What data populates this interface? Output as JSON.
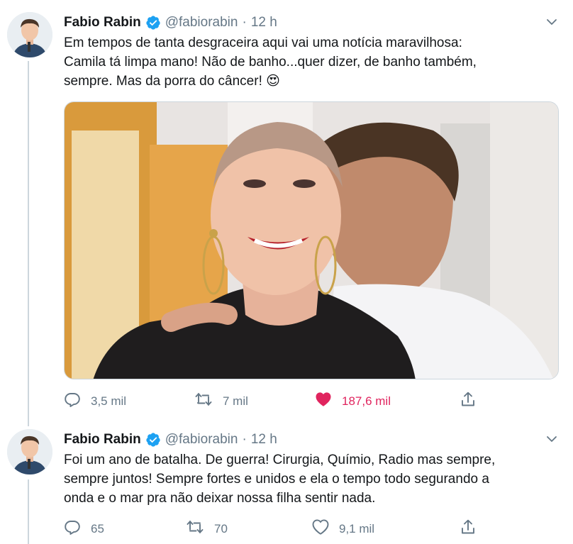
{
  "tweets": [
    {
      "name": "Fabio Rabin",
      "handle": "@fabiorabin",
      "dot": "·",
      "time": "12 h",
      "text": "Em tempos de tanta desgraceira aqui vai uma notícia maravilhosa:\nCamila tá limpa mano! Não de banho...quer dizer, de banho também,\nsempre. Mas da porra do câncer! 😍",
      "reply_count": "3,5 mil",
      "retweet_count": "7 mil",
      "like_count": "187,6 mil",
      "liked": true
    },
    {
      "name": "Fabio Rabin",
      "handle": "@fabiorabin",
      "dot": "·",
      "time": "12 h",
      "text": "Foi um ano de batalha. De guerra! Cirurgia, Químio, Radio mas sempre,\nsempre juntos! Sempre fortes e unidos e ela o tempo todo segurando a\nonda e o mar pra não deixar nossa filha sentir nada.",
      "reply_count": "65",
      "retweet_count": "70",
      "like_count": "9,1 mil",
      "liked": false
    }
  ],
  "colors": {
    "text": "#14171a",
    "secondary": "#657786",
    "like": "#e0245e",
    "verified": "#1da1f2",
    "thread_line": "#ccd6dd"
  },
  "icons": [
    "verified-badge-icon",
    "chevron-down-icon",
    "reply-icon",
    "retweet-icon",
    "heart-icon",
    "share-icon"
  ]
}
